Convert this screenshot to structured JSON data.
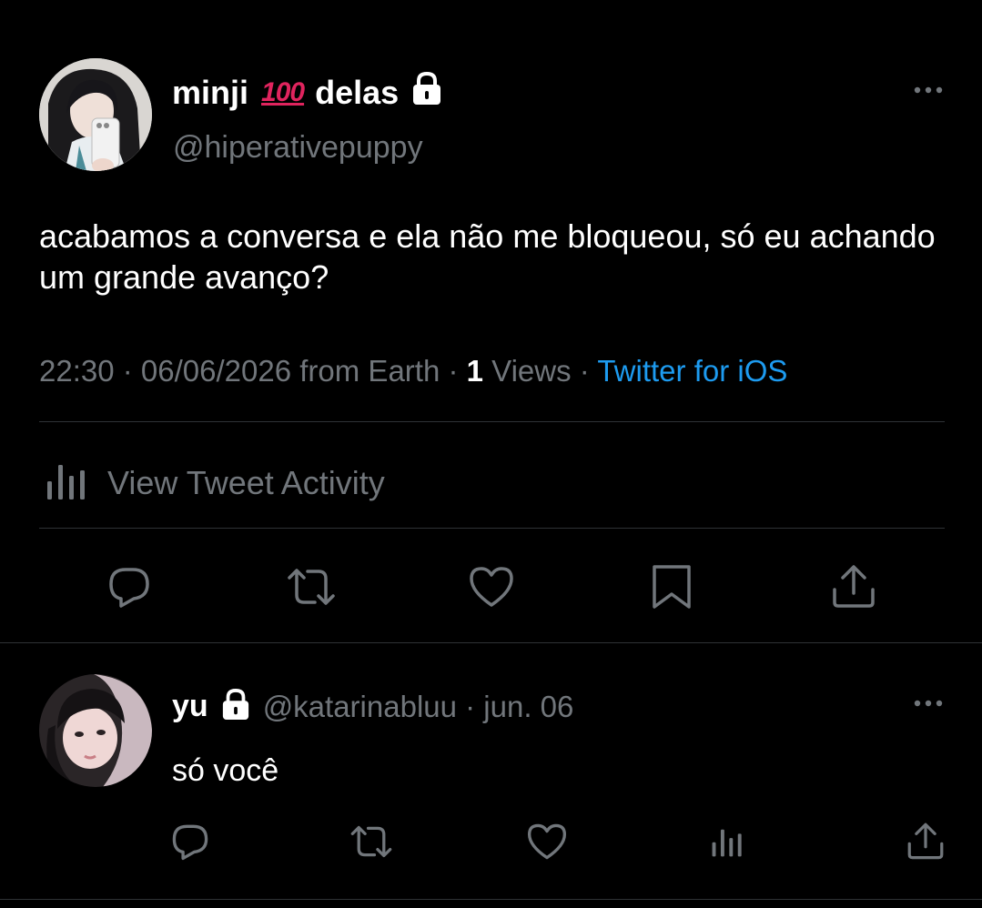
{
  "tweet": {
    "author": {
      "name_part1": "minji",
      "emoji": "100",
      "name_part2": "delas",
      "handle": "@hiperativepuppy",
      "locked_icon": "lock-icon",
      "avatar_icon": "profile-photo"
    },
    "text": "acabamos a conversa e ela não me bloqueou, só eu achando um grande avanço?",
    "meta": {
      "time": "22:30",
      "sep1": " · ",
      "date": "06/06/2026",
      "location": " from Earth",
      "sep2": " · ",
      "views_count": "1",
      "views_label": " Views",
      "sep3": " · ",
      "client": "Twitter for iOS"
    },
    "activity_label": "View Tweet Activity",
    "actions": [
      "reply-icon",
      "retweet-icon",
      "like-icon",
      "bookmark-icon",
      "share-icon"
    ]
  },
  "reply": {
    "author": {
      "name": "yu",
      "handle_date": "@katarinabluu · jun. 06",
      "locked_icon": "lock-icon",
      "avatar_icon": "profile-photo"
    },
    "text": "só você",
    "actions": [
      "reply-icon",
      "retweet-icon",
      "like-icon",
      "analytics-icon",
      "share-icon"
    ]
  },
  "colors": {
    "background": "#000000",
    "text": "#ffffff",
    "secondary": "#71767b",
    "link": "#1d9bf0",
    "divider": "#2f3336",
    "emoji": "#e0245e"
  }
}
